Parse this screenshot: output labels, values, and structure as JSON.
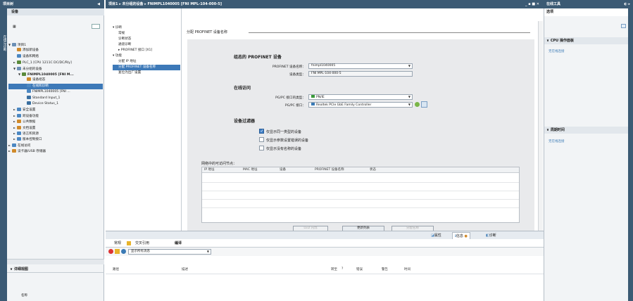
{
  "left_panel": {
    "title": "项目树",
    "tab": "设备",
    "tree": [
      {
        "label": "项目1",
        "indent": 0,
        "arrow": "▼",
        "color": "#6b8fb5"
      },
      {
        "label": "添加新设备",
        "indent": 1,
        "arrow": "",
        "color": "#d08a2a"
      },
      {
        "label": "设备和网络",
        "indent": 1,
        "arrow": "",
        "color": "#4b87c2"
      },
      {
        "label": "PLC_1 [CPU 1211C DC/DC/Rly]",
        "indent": 1,
        "arrow": "►",
        "color": "#5a8a3a"
      },
      {
        "label": "未分组的设备",
        "indent": 1,
        "arrow": "▼",
        "color": "#6b8fb5"
      },
      {
        "label": "FNIMPL1040005 [FNI M...",
        "indent": 2,
        "arrow": "▼",
        "color": "#5a8a3a",
        "bold": true
      },
      {
        "label": "设备组态",
        "indent": 3,
        "arrow": "",
        "color": "#d08a2a"
      },
      {
        "label": "在线和诊断",
        "indent": 3,
        "arrow": "",
        "color": "#4b87c2",
        "selected": true
      },
      {
        "label": "FNIMPL1040005 [FNI ...",
        "indent": 3,
        "arrow": "",
        "color": "#4b87c2"
      },
      {
        "label": "Standard Input_1",
        "indent": 3,
        "arrow": "",
        "color": "#3a6fa0"
      },
      {
        "label": "Device Status_1",
        "indent": 3,
        "arrow": "",
        "color": "#3a6fa0"
      },
      {
        "label": "安全设置",
        "indent": 1,
        "arrow": "►",
        "color": "#4b87c2"
      },
      {
        "label": "跨设备功能",
        "indent": 1,
        "arrow": "►",
        "color": "#4b87c2"
      },
      {
        "label": "公共数据",
        "indent": 1,
        "arrow": "►",
        "color": "#d08a2a"
      },
      {
        "label": "文档设置",
        "indent": 1,
        "arrow": "►",
        "color": "#d08a2a"
      },
      {
        "label": "语言和资源",
        "indent": 1,
        "arrow": "►",
        "color": "#4b87c2"
      },
      {
        "label": "版本控制接口",
        "indent": 1,
        "arrow": "►",
        "color": "#4b87c2"
      },
      {
        "label": "在线访问",
        "indent": 0,
        "arrow": "►",
        "color": "#4b87c2"
      },
      {
        "label": "读卡器/USB 存储器",
        "indent": 0,
        "arrow": "►",
        "color": "#d08a2a"
      }
    ],
    "details_title": "详细视图",
    "details_col": "名称",
    "side_tab": "在线与诊断"
  },
  "breadcrumb": "项目1 ▸ 未分组的设备 ▸ FNIMPL1040005 [FNI MPL-104-000-5]",
  "window_controls": "_ ▪ ■ ✕",
  "nav": {
    "items": [
      {
        "label": "▾ 诊断",
        "indent": 0
      },
      {
        "label": "常规",
        "indent": 1
      },
      {
        "label": "诊断状态",
        "indent": 1
      },
      {
        "label": "通道诊断",
        "indent": 1
      },
      {
        "label": "▸ PROFINET 接口 [X1]",
        "indent": 1
      },
      {
        "label": "▾ 功能",
        "indent": 0
      },
      {
        "label": "分配 IP 地址",
        "indent": 1
      },
      {
        "label": "分配 PROFINET 设备名称",
        "indent": 1,
        "selected": true
      },
      {
        "label": "复位为出厂设置",
        "indent": 1
      }
    ]
  },
  "main": {
    "section_title": "分配 PROFINET 设备名称",
    "configured": {
      "heading": "组态的 PROFINET 设备",
      "name_label": "PROFINET 设备名称：",
      "name_value": "fnimpl1040005",
      "type_label": "设备类型：",
      "type_value": "FNI MPL-104-000-5"
    },
    "online": {
      "heading": "在线访问",
      "iface_type_label": "PG/PC 接口的类型：",
      "iface_type_value": "PN/IE",
      "iface_label": "PG/PC 接口：",
      "iface_value": "Realtek PCIe GbE Family Controller"
    },
    "filter": {
      "heading": "设备过滤器",
      "options": [
        {
          "label": "仅显示同一类型的设备",
          "checked": true
        },
        {
          "label": "仅显示参数设置错误的设备",
          "checked": false
        },
        {
          "label": "仅显示没有名称的设备",
          "checked": false
        }
      ]
    },
    "table": {
      "caption": "网络中的可访问节点：",
      "columns": [
        "IP 地址",
        "MAC 地址",
        "设备",
        "PROFINET 设备名称",
        "状态"
      ]
    },
    "buttons": {
      "flash": "LED 闪烁",
      "update": "更新列表",
      "assign": "分配名称"
    }
  },
  "inspector": {
    "tabs_right": [
      "属性",
      "信息",
      "诊断"
    ],
    "tabs": [
      "常规",
      "交叉引用",
      "编译"
    ],
    "filter_text": "显示所有消息",
    "columns": [
      "路径",
      "描述",
      "转至",
      "?",
      "错误",
      "警告",
      "时间"
    ]
  },
  "right_panel": {
    "title": "在线工具",
    "tab": "选项",
    "sections": [
      {
        "title": "CPU 操作面板",
        "text": "无在线连接"
      },
      {
        "title": "周期时间",
        "text": "无在线连接"
      }
    ]
  },
  "colors": {
    "title_bar": "#3b5a74",
    "selected": "#3d79b8",
    "panel": "#f2f4f6"
  }
}
